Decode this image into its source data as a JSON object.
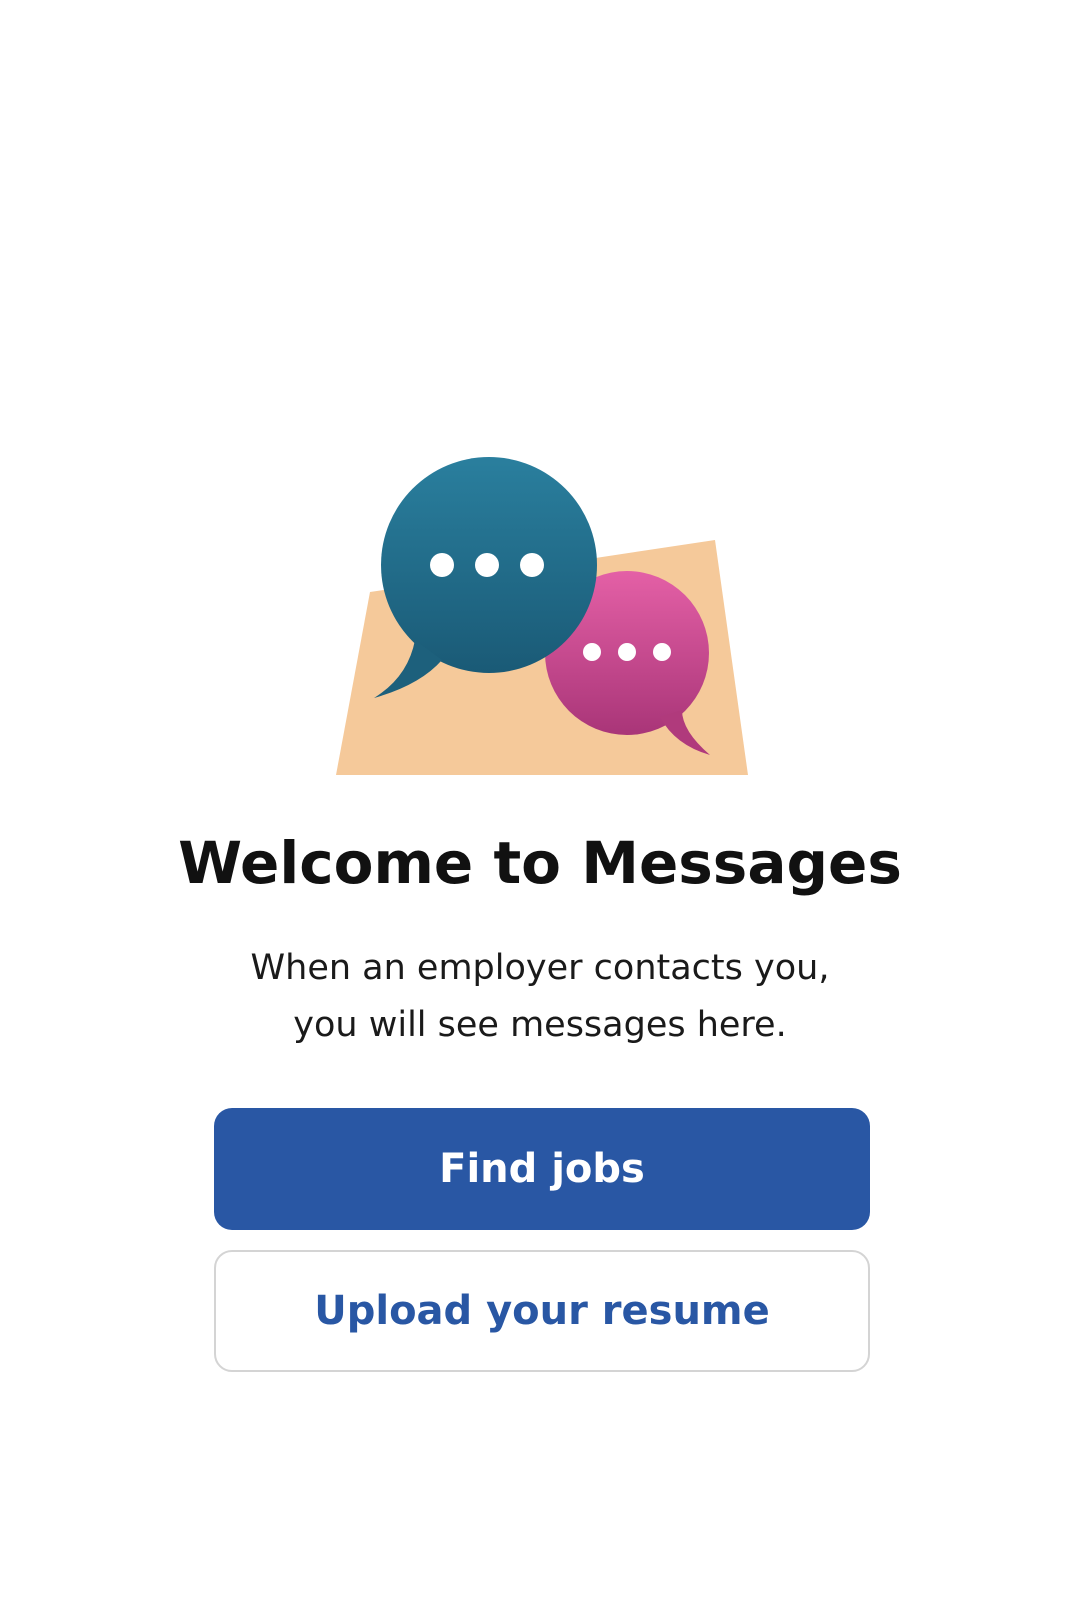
{
  "empty_state": {
    "illustration_icon": "chat-bubbles-illustration",
    "title": "Welcome to Messages",
    "description_line1": "When an employer contacts you,",
    "description_line2": "you will see messages here."
  },
  "actions": {
    "find_jobs_label": "Find jobs",
    "upload_resume_label": "Upload your resume"
  },
  "colors": {
    "primary": "#2957a4",
    "primary_text": "#ffffff",
    "secondary_text": "#2957a4",
    "bubble_teal": "#22708f",
    "bubble_pink": "#d2509a",
    "paper": "#f5c99a"
  }
}
